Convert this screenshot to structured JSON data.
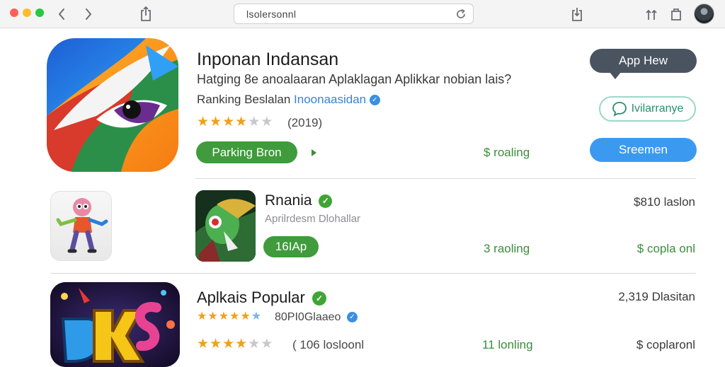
{
  "browser": {
    "url": "lsolersonnl"
  },
  "featured": {
    "title": "Inponan Indansan",
    "subtitle": "Hatging 8e anoalaaran Aplaklagan Aplikkar nobian lais?",
    "ranking_label": "Ranking Beslalan",
    "ranking_link": "Inoonaasidan",
    "rating": 4,
    "rating_count": "(2019)",
    "primary_button": "Parking Bron",
    "price_text": "$ roaling",
    "bubble_label": "App Hew",
    "outline_button": "Ivilarranye",
    "blue_button": "Sreemen"
  },
  "apps": [
    {
      "title": "Rnania",
      "developer": "Aprilrdesm Dlohallar",
      "button": "16IAp",
      "middle_text": "3 raoling",
      "top_right": "$810 laslon",
      "bottom_right": "$ copla onl"
    },
    {
      "title": "Aplkais Popular",
      "rating_a": 5,
      "rating_a_text": "80PI0Glaaeo",
      "rating_b": 4,
      "rating_b_text": "( 106 losloonl",
      "middle_text": "11 lonling",
      "top_right": "2,319 Dlasitan",
      "bottom_right": "$ coplaronl"
    }
  ],
  "colors": {
    "accent_green": "#3f9b3b",
    "accent_blue": "#3b9af0",
    "star": "#f0a11b"
  }
}
